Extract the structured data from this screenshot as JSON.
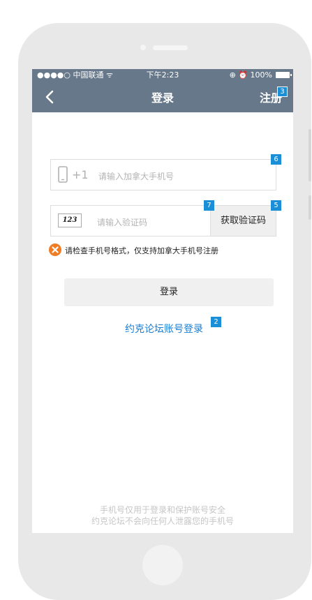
{
  "status_bar": {
    "carrier": "●●●●○ 中国联通 ᯤ",
    "time": "下午2:23",
    "right": "⊕ ⏰ 100%"
  },
  "nav": {
    "back_icon": "chevron-left-icon",
    "title": "登录",
    "register_label": "注册"
  },
  "form": {
    "phone_prefix": "+1",
    "phone_placeholder": "请输入加拿大手机号",
    "captcha_image_text": "123",
    "code_placeholder": "请输入验证码",
    "get_code_label": "获取验证码",
    "error_message": "请检查手机号格式，仅支持加拿大手机号注册",
    "login_label": "登录",
    "alt_login_label": "约克论坛账号登录"
  },
  "footer": {
    "line1": "手机号仅用于登录和保护账号安全",
    "line2": "约克论坛不会向任何人泄露您的手机号"
  },
  "markers": {
    "register": "3",
    "phone_input": "6",
    "code_input": "7",
    "get_code": "5",
    "alt_login": "2"
  },
  "colors": {
    "navbar": "#66788a",
    "link": "#1a7fd4",
    "marker": "#1a8fd8",
    "error_icon": "#f07c24"
  }
}
